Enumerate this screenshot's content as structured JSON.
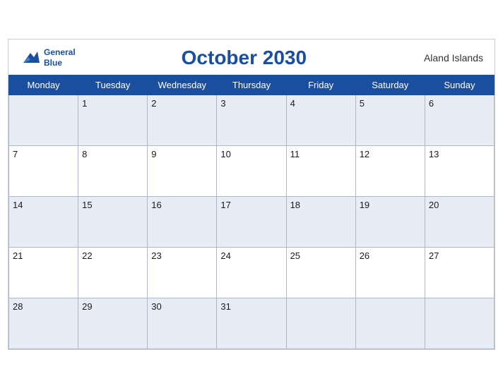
{
  "header": {
    "title": "October 2030",
    "region": "Aland Islands",
    "logo_general": "General",
    "logo_blue": "Blue"
  },
  "weekdays": [
    "Monday",
    "Tuesday",
    "Wednesday",
    "Thursday",
    "Friday",
    "Saturday",
    "Sunday"
  ],
  "weeks": [
    [
      "",
      "1",
      "2",
      "3",
      "4",
      "5",
      "6"
    ],
    [
      "7",
      "8",
      "9",
      "10",
      "11",
      "12",
      "13"
    ],
    [
      "14",
      "15",
      "16",
      "17",
      "18",
      "19",
      "20"
    ],
    [
      "21",
      "22",
      "23",
      "24",
      "25",
      "26",
      "27"
    ],
    [
      "28",
      "29",
      "30",
      "31",
      "",
      "",
      ""
    ]
  ]
}
